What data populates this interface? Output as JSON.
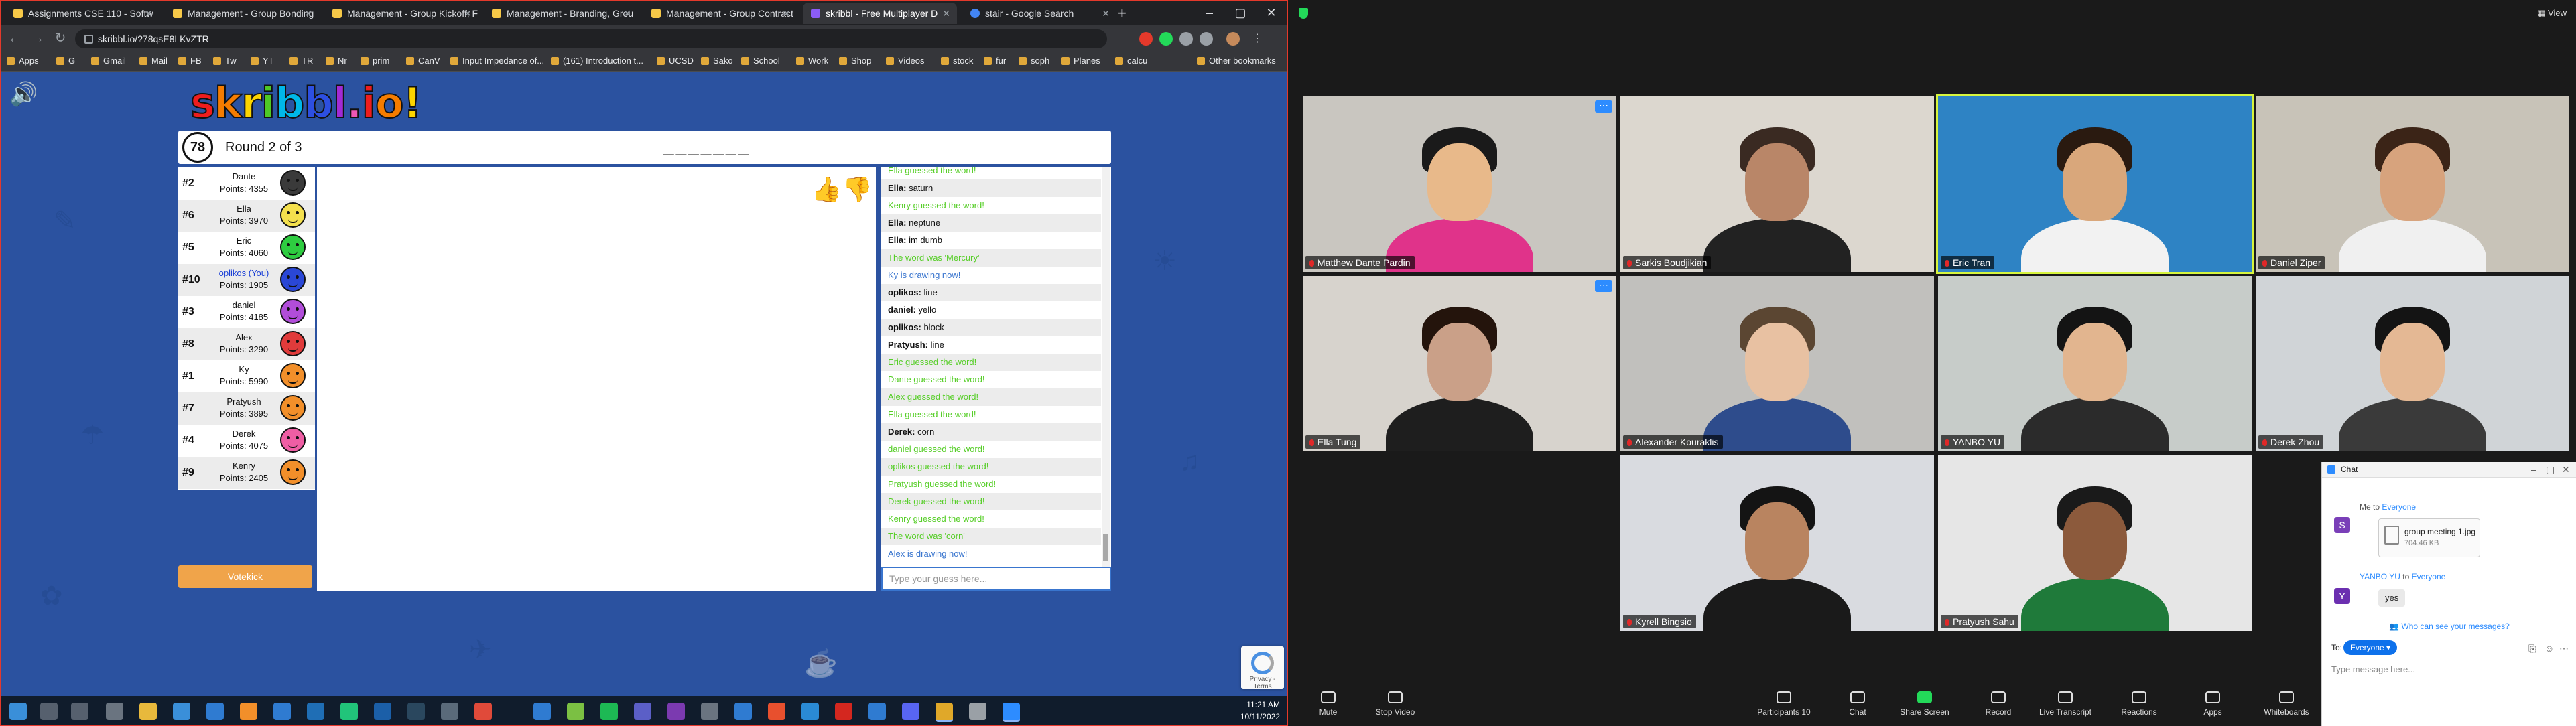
{
  "browser": {
    "tabs": [
      {
        "label": "Assignments CSE 110 - Softw"
      },
      {
        "label": "Management - Group Bonding"
      },
      {
        "label": "Management - Group Kickoff, F"
      },
      {
        "label": "Management - Branding, Grou"
      },
      {
        "label": "Management - Group Contract"
      },
      {
        "label": "skribbl - Free Multiplayer D"
      },
      {
        "label": "stair - Google Search"
      }
    ],
    "url": "skribbl.io/?78qsE8LKvZTR",
    "bookmarks": [
      "Apps",
      "G",
      "Gmail",
      "Mail",
      "FB",
      "Tw",
      "YT",
      "TR",
      "Nr",
      "prim",
      "CanV",
      "Input Impedance of...",
      "(161) Introduction t...",
      "UCSD",
      "Sako",
      "School",
      "Work",
      "Shop",
      "Videos",
      "stock",
      "fur",
      "soph",
      "Planes",
      "calcu",
      "Other bookmarks"
    ]
  },
  "game": {
    "logo": "skribbl.io!",
    "timer": "78",
    "round": "Round 2 of 3",
    "word_hint": "_______",
    "players": [
      {
        "rank": "#2",
        "name": "Dante",
        "points": "Points: 4355",
        "color": "#3a3a3a"
      },
      {
        "rank": "#6",
        "name": "Ella",
        "points": "Points: 3970",
        "color": "#f4e04d"
      },
      {
        "rank": "#5",
        "name": "Eric",
        "points": "Points: 4060",
        "color": "#2ecc40"
      },
      {
        "rank": "#10",
        "name": "oplikos (You)",
        "points": "Points: 1905",
        "color": "#2a47d6"
      },
      {
        "rank": "#3",
        "name": "daniel",
        "points": "Points: 4185",
        "color": "#b14dd9"
      },
      {
        "rank": "#8",
        "name": "Alex",
        "points": "Points: 3290",
        "color": "#e03b3b"
      },
      {
        "rank": "#1",
        "name": "Ky",
        "points": "Points: 5990",
        "color": "#f28f2a"
      },
      {
        "rank": "#7",
        "name": "Pratyush",
        "points": "Points: 3895",
        "color": "#f28f2a"
      },
      {
        "rank": "#4",
        "name": "Derek",
        "points": "Points: 4075",
        "color": "#ef5ea4"
      },
      {
        "rank": "#9",
        "name": "Kenry",
        "points": "Points: 2405",
        "color": "#f28f2a"
      }
    ],
    "votekick_label": "Votekick",
    "chat_placeholder": "Type your guess here...",
    "chat": [
      {
        "who": "",
        "text": "Ella guessed the word!",
        "kind": "green"
      },
      {
        "who": "Ella:",
        "text": " saturn",
        "kind": "msg"
      },
      {
        "who": "",
        "text": "Kenry guessed the word!",
        "kind": "green"
      },
      {
        "who": "Ella:",
        "text": " neptune",
        "kind": "msg"
      },
      {
        "who": "Ella:",
        "text": " im dumb",
        "kind": "msg"
      },
      {
        "who": "",
        "text": "The word was 'Mercury'",
        "kind": "green"
      },
      {
        "who": "",
        "text": "Ky is drawing now!",
        "kind": "blue"
      },
      {
        "who": "oplikos:",
        "text": " line",
        "kind": "msg"
      },
      {
        "who": "daniel:",
        "text": " yello",
        "kind": "msg"
      },
      {
        "who": "oplikos:",
        "text": " block",
        "kind": "msg"
      },
      {
        "who": "Pratyush:",
        "text": " line",
        "kind": "msg"
      },
      {
        "who": "",
        "text": "Eric guessed the word!",
        "kind": "green"
      },
      {
        "who": "",
        "text": "Dante guessed the word!",
        "kind": "green"
      },
      {
        "who": "",
        "text": "Alex guessed the word!",
        "kind": "green"
      },
      {
        "who": "",
        "text": "Ella guessed the word!",
        "kind": "green"
      },
      {
        "who": "Derek:",
        "text": " corn",
        "kind": "msg"
      },
      {
        "who": "",
        "text": "daniel guessed the word!",
        "kind": "green"
      },
      {
        "who": "",
        "text": "oplikos guessed the word!",
        "kind": "green"
      },
      {
        "who": "",
        "text": "Pratyush guessed the word!",
        "kind": "green"
      },
      {
        "who": "",
        "text": "Derek guessed the word!",
        "kind": "green"
      },
      {
        "who": "",
        "text": "Kenry guessed the word!",
        "kind": "green"
      },
      {
        "who": "",
        "text": "The word was 'corn'",
        "kind": "green"
      },
      {
        "who": "",
        "text": "Alex is drawing now!",
        "kind": "blue"
      }
    ],
    "recaptcha_text": "Privacy - Terms"
  },
  "taskbar": {
    "time": "11:21 AM",
    "date": "10/11/2022"
  },
  "zoom": {
    "view_label": "View",
    "participants": [
      {
        "name": "Matthew Dante Pardin",
        "bg": "#c9c6c0",
        "skin": "#e8b98a",
        "hair": "#1a1a1a",
        "shirt": "#e0338a",
        "more": true,
        "speaking": false
      },
      {
        "name": "Sarkis Boudjikian",
        "bg": "#dcd7cf",
        "skin": "#b98668",
        "hair": "#3a2a22",
        "shirt": "#222222",
        "more": false,
        "speaking": false
      },
      {
        "name": "Eric Tran",
        "bg": "#2e83c4",
        "skin": "#d9a77b",
        "hair": "#2a1a10",
        "shirt": "#f2f2f2",
        "more": false,
        "speaking": true
      },
      {
        "name": "Daniel Ziper",
        "bg": "#c8c3b8",
        "skin": "#d7a37d",
        "hair": "#3b2417",
        "shirt": "#f0f0f0",
        "more": false,
        "speaking": false
      },
      {
        "name": "Ella Tung",
        "bg": "#d7d3cd",
        "skin": "#caa088",
        "hair": "#24140c",
        "shirt": "#1e1e1e",
        "more": true,
        "speaking": false
      },
      {
        "name": "Alexander Kouraklis",
        "bg": "#c1c0bd",
        "skin": "#e8c1a2",
        "hair": "#5b4632",
        "shirt": "#2e4c8c",
        "more": false,
        "speaking": false
      },
      {
        "name": "YANBO YU",
        "bg": "#c7ccc9",
        "skin": "#e2b58f",
        "hair": "#141414",
        "shirt": "#2b2b2b",
        "more": false,
        "speaking": false
      },
      {
        "name": "Derek Zhou",
        "bg": "#d0d4d7",
        "skin": "#e4b894",
        "hair": "#141414",
        "shirt": "#3a3a3a",
        "more": false,
        "speaking": false
      },
      {
        "name": "Kyrell Bingsio",
        "bg": "#d9dbe0",
        "skin": "#b98460",
        "hair": "#141414",
        "shirt": "#1a1a1a",
        "more": false,
        "speaking": false
      },
      {
        "name": "Pratyush Sahu",
        "bg": "#e6e6e6",
        "skin": "#8c5a3c",
        "hair": "#1a1a1a",
        "shirt": "#1f7a3a",
        "more": false,
        "speaking": false
      }
    ],
    "chat_panel": {
      "title": "Chat",
      "msg1_from": "Me to",
      "msg1_to": "Everyone",
      "file_name": "group meeting 1.jpg",
      "file_size": "704.46 KB",
      "msg2_from": "YANBO YU",
      "msg2_mid": "to",
      "msg2_to": "Everyone",
      "msg2_text": "yes",
      "avatar1": "S",
      "avatar2": "Y",
      "who_can_see": "Who can see your messages?",
      "to_label": "To:",
      "to_value": "Everyone",
      "input_placeholder": "Type message here..."
    },
    "toolbar": [
      {
        "label": "Mute",
        "x": 0
      },
      {
        "label": "Stop Video",
        "x": 0
      },
      {
        "label": "Participants",
        "count": "10"
      },
      {
        "label": "Chat"
      },
      {
        "label": "Share Screen"
      },
      {
        "label": "Record"
      },
      {
        "label": "Live Transcript"
      },
      {
        "label": "Reactions"
      },
      {
        "label": "Apps"
      },
      {
        "label": "Whiteboards"
      }
    ]
  }
}
